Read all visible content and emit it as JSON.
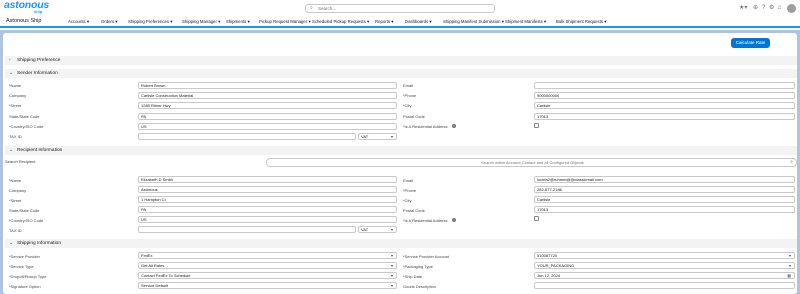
{
  "header": {
    "logo_main": "astonous",
    "logo_sub": "ship",
    "search_placeholder": "Search...",
    "icons": [
      "favorites-icon",
      "add-icon",
      "help-icon",
      "settings-icon",
      "notifications-icon"
    ]
  },
  "nav": {
    "app_name": "Astonous Ship",
    "items": [
      "Accounts",
      "Orders",
      "Shipping Preferences",
      "Shipping Manager",
      "Shipments",
      "Pickup Request Manager",
      "Scheduled Pickup Requests",
      "Reports",
      "Dashboards",
      "Shipping Manifest Submission",
      "Shipment Manifests",
      "Bulk Shipment Requests"
    ]
  },
  "actions": {
    "calculate_rate": "Calculate Rate"
  },
  "shipping_preference": {
    "title": "Shipping Preference"
  },
  "sender": {
    "title": "Sender Information",
    "name_label": "*Name",
    "name": "Robert Brown",
    "company_label": "Company",
    "company": "Carlisle Construction Material",
    "street_label": "*Street",
    "street": "1285 Ritner Hwy",
    "state_label": "State/State Code",
    "state": "PA",
    "country_label": "*Country/ISO Code",
    "country": "US",
    "tax_label": "TAX ID",
    "tax": "",
    "tax_type": "VAT",
    "email_label": "Email",
    "email": "",
    "phone_label": "*Phone",
    "phone": "9000000000",
    "city_label": "*City",
    "city": "Carlisle",
    "postal_label": "Postal Code",
    "postal": "17013",
    "residential_label": "*Is A Residential Address"
  },
  "recipient": {
    "title": "Recipient Information",
    "search_label": "Search Recipient",
    "search_placeholder": "Search within Account,Contact and all Configured Objects",
    "name_label": "*Name",
    "name": "Elizabeth D Smith",
    "company_label": "Company",
    "company": "Astonous",
    "street_label": "*Street",
    "street": "1 Hampton Ct",
    "state_label": "State/State Code",
    "state": "PA",
    "country_label": "*Country/ISO Code",
    "country": "US",
    "tax_label": "TAX ID",
    "tax": "",
    "tax_type": "VAT",
    "email_label": "Email",
    "email": "lucirfa2@ruhmm@@classicmail.com",
    "phone_label": "*Phone",
    "phone": "282-877-2186",
    "city_label": "*City",
    "city": "Carlisle",
    "postal_label": "Postal Code",
    "postal": "17013",
    "residential_label": "*Is A Residential Address"
  },
  "shipping": {
    "title": "Shipping Information",
    "provider_label": "*Service Provider",
    "provider": "FedEx",
    "type_label": "*Service Type",
    "type": "Get All Rates",
    "dropoff_label": "*Dropoff/Pickup Type",
    "dropoff": "Contact FedEx To Schedule",
    "signature_label": "*Signature Option",
    "signature": "Service Default",
    "account_label": "*Service Provider Account",
    "account": "510087720",
    "packaging_label": "*Packaging Type",
    "packaging": "YOUR_PACKAGING",
    "shipdate_label": "*Ship Date",
    "shipdate": "Jun 12, 2024",
    "goods_label": "Goods Description",
    "goods": ""
  }
}
